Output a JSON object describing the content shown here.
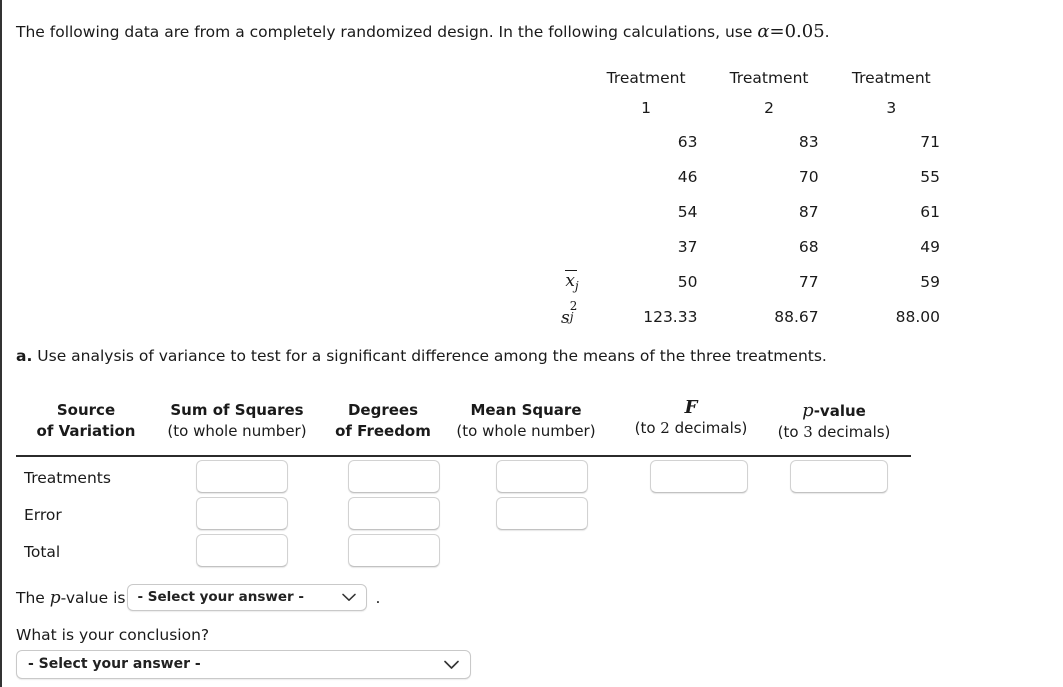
{
  "intro": {
    "text_before": "The following data are from a completely randomized design. In the following calculations, use",
    "alpha_symbol": "α",
    "equals": "=",
    "alpha_value": "0.05",
    "period": "."
  },
  "data_table": {
    "headers_line1": [
      "Treatment",
      "Treatment",
      "Treatment"
    ],
    "headers_line2": [
      "1",
      "2",
      "3"
    ],
    "rows": [
      [
        "63",
        "83",
        "71"
      ],
      [
        "46",
        "70",
        "55"
      ],
      [
        "54",
        "87",
        "61"
      ],
      [
        "37",
        "68",
        "49"
      ]
    ],
    "mean_label_base": "x",
    "mean_label_sub": "j",
    "means": [
      "50",
      "77",
      "59"
    ],
    "variance_label_base": "s",
    "variance_label_sup": "2",
    "variance_label_sub": "j",
    "variances": [
      "123.33",
      "88.67",
      "88.00"
    ]
  },
  "part_a": {
    "marker": "a.",
    "text": "Use analysis of variance to test for a significant difference among the means of the three treatments."
  },
  "anova": {
    "columns": [
      {
        "title_line1": "Source",
        "title_line2": "of Variation",
        "note": ""
      },
      {
        "title_line1": "Sum of Squares",
        "title_line2": "",
        "note": "(to whole number)"
      },
      {
        "title_line1": "Degrees",
        "title_line2": "of Freedom",
        "note": ""
      },
      {
        "title_line1": "Mean Square",
        "title_line2": "",
        "note": "(to whole number)"
      },
      {
        "title_line1": "F",
        "title_line2": "",
        "note_pre": "(to ",
        "note_num": "2",
        "note_post": " decimals)"
      },
      {
        "title_line1": "p",
        "title_line1_suffix": "-value",
        "title_line2": "",
        "note_pre": "(to ",
        "note_num": "3",
        "note_post": " decimals)"
      }
    ],
    "rows": [
      {
        "label": "Treatments",
        "input_count": 5
      },
      {
        "label": "Error",
        "input_count": 3
      },
      {
        "label": "Total",
        "input_count": 2
      }
    ]
  },
  "p_value_line": {
    "lead_text_1": "The ",
    "lead_italic": "p",
    "lead_text_2": "-value is",
    "select_value": "- Select your answer -",
    "trailing": "."
  },
  "conclusion": {
    "question": "What is your conclusion?",
    "select_value": "- Select your answer -"
  },
  "icons": {
    "chevron_down": "chevron-down-icon"
  },
  "colors": {
    "text": "#1a1a1a",
    "border": "#d2d2d2",
    "rule": "#2b2b2b",
    "background": "#ffffff"
  }
}
